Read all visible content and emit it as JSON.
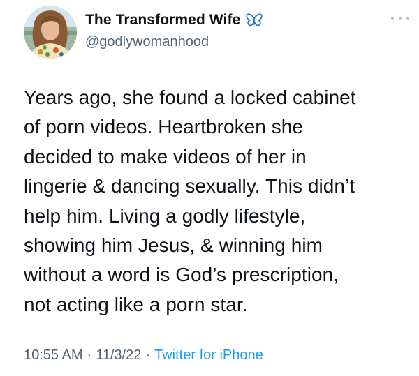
{
  "author": {
    "display_name": "The Transformed Wife",
    "handle": "@godlywomanhood",
    "badge_icon": "butterfly-icon",
    "badge_color": "#2a79d6"
  },
  "tweet": {
    "text": "Years ago, she found a locked cabinet\nof porn videos. Heartbroken she\ndecided to make videos of her in\nlingerie & dancing sexually. This didn’t\nhelp him. Living a godly lifestyle,\nshowing him Jesus, & winning him\nwithout a word is God’s prescription,\nnot acting like a porn star.",
    "time": "10:55 AM",
    "date": "11/3/22",
    "separator": "·",
    "source": "Twitter for iPhone"
  },
  "colors": {
    "text": "#0f1419",
    "secondary": "#536471",
    "link": "#1d9bf0"
  }
}
